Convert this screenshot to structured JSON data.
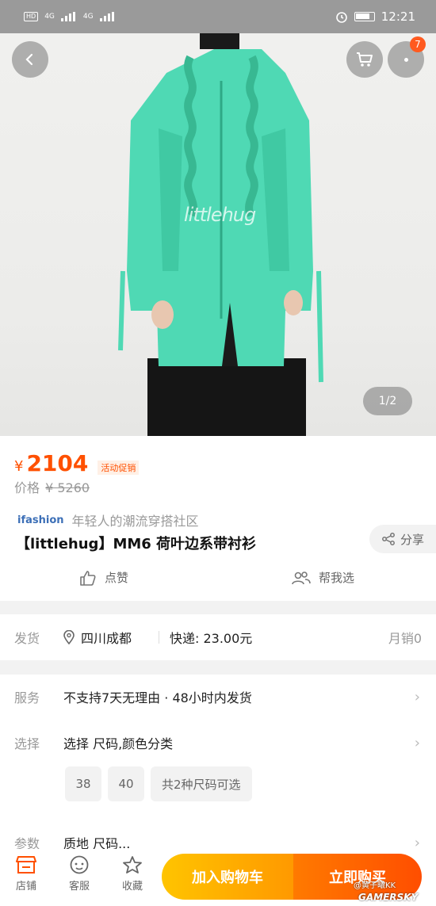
{
  "status_bar": {
    "left_indicators": [
      "HD",
      "4G",
      "4G"
    ],
    "time": "12:21"
  },
  "header": {
    "cart_badge": "7"
  },
  "hero": {
    "watermark": "littlehug",
    "pager": "1/2"
  },
  "price": {
    "currency": "¥",
    "current": "2104",
    "promo_tag": "活动促销",
    "original_label": "价格",
    "original_value": "¥ 5260"
  },
  "brand": {
    "logo": "ifashion",
    "slogan": "年轻人的潮流穿搭社区"
  },
  "product": {
    "title": "【littlehug】MM6 荷叶边系带衬衫",
    "share_label": "分享",
    "like_label": "点赞",
    "help_label": "帮我选"
  },
  "shipping": {
    "label": "发货",
    "location": "四川成都",
    "fee": "快递: 23.00元",
    "sales": "月销0"
  },
  "service": {
    "service_label": "服务",
    "service_value": "不支持7天无理由 · 48小时内发货",
    "select_label": "选择",
    "select_value": "选择 尺码,颜色分类",
    "sizes": [
      "38",
      "40",
      "共2种尺码可选"
    ],
    "params_label": "参数",
    "params_value": "质地 尺码..."
  },
  "bottom_bar": {
    "store_label": "店铺",
    "service_label": "客服",
    "fav_label": "收藏",
    "add_cart_label": "加入购物车",
    "buy_now_label": "立即购买"
  },
  "overlay_watermark": {
    "line1": "@黄子曦KK",
    "line2": "GAMERSKY"
  },
  "colors": {
    "accent": "#ff5000",
    "cart_button": "#ffb300",
    "buy_button": "#ff5a00"
  }
}
